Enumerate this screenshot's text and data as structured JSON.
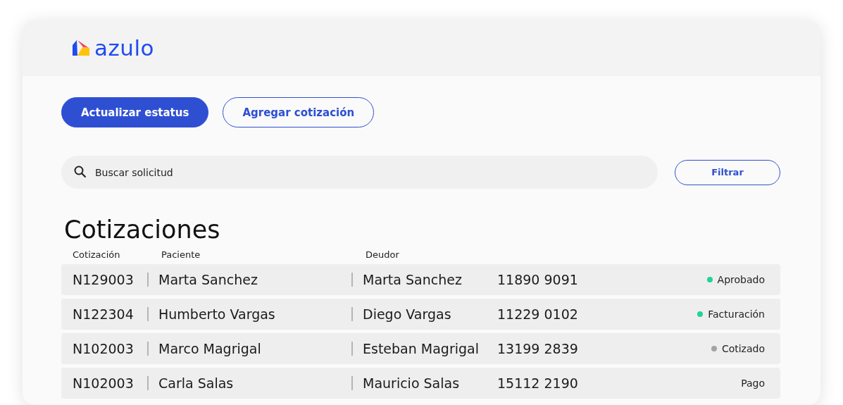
{
  "header": {
    "logo_text": "azulo"
  },
  "actions": [
    {
      "label": "Actualizar estatus",
      "kind": "primary"
    },
    {
      "label": "Agregar cotización",
      "kind": "outline"
    }
  ],
  "search": {
    "placeholder": "Buscar solicitud"
  },
  "filter_button": {
    "label": "Filtrar"
  },
  "title": "Cotizaciones",
  "table": {
    "columns": [
      "Cotización",
      "Paciente",
      "Deudor"
    ],
    "rows": [
      {
        "id": "N129003",
        "patient": "Marta Sanchez",
        "debtor": "Marta Sanchez",
        "phone": "11890 9091",
        "status": "Aprobado",
        "color": "#22d39a"
      },
      {
        "id": "N122304",
        "patient": "Humberto Vargas",
        "debtor": "Diego Vargas",
        "phone": "11229 0102",
        "status": "Facturación",
        "color": "#22d39a"
      },
      {
        "id": "N102003",
        "patient": "Marco Magrigal",
        "debtor": "Esteban Magrigal",
        "phone": "13199 2839",
        "status": "Cotizado",
        "color": "#a3a3a3"
      },
      {
        "id": "N102003",
        "patient": "Carla Salas",
        "debtor": "Mauricio Salas",
        "phone": "15112 2190",
        "status": "Pago"
      }
    ]
  }
}
